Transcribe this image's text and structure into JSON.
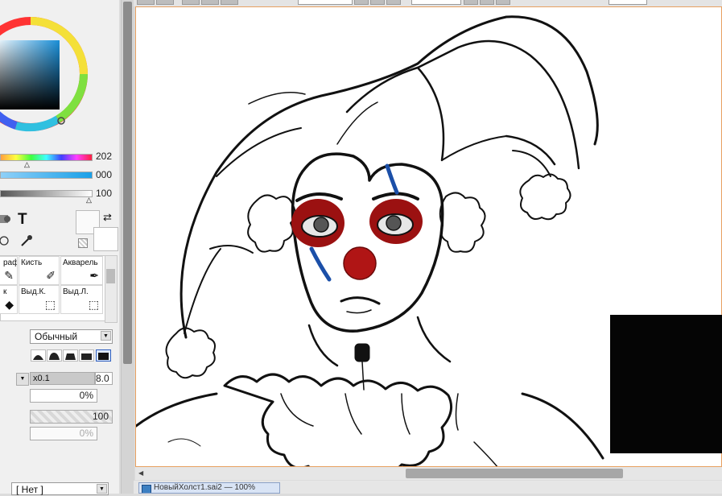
{
  "color_panel": {
    "slider_values": [
      "202",
      "000",
      "100"
    ],
    "accent": "#2f9fd8"
  },
  "tools": {
    "text_tool_glyph": "T",
    "swap_glyph": "⇄",
    "brush_cells": [
      {
        "label": "раф",
        "icon": "pencil-icon"
      },
      {
        "label": "Кисть",
        "icon": "brush-icon"
      },
      {
        "label": "Акварель",
        "icon": "watercolor-icon"
      },
      {
        "label": "к",
        "icon": "eraser-icon"
      },
      {
        "label": "Выд.К.",
        "icon": "select-pen-icon"
      },
      {
        "label": "Выд.Л.",
        "icon": "select-eraser-icon"
      }
    ]
  },
  "brush_settings": {
    "blend_mode": "Обычный",
    "size_multiplier": "x0.1",
    "size_value": "8.0",
    "min_size": "0%",
    "density": "100",
    "texture_strength": "0%",
    "texture_select": "[ Нет ]"
  },
  "document": {
    "tab_label": "НовыйХолст1.sai2 — 100%"
  }
}
